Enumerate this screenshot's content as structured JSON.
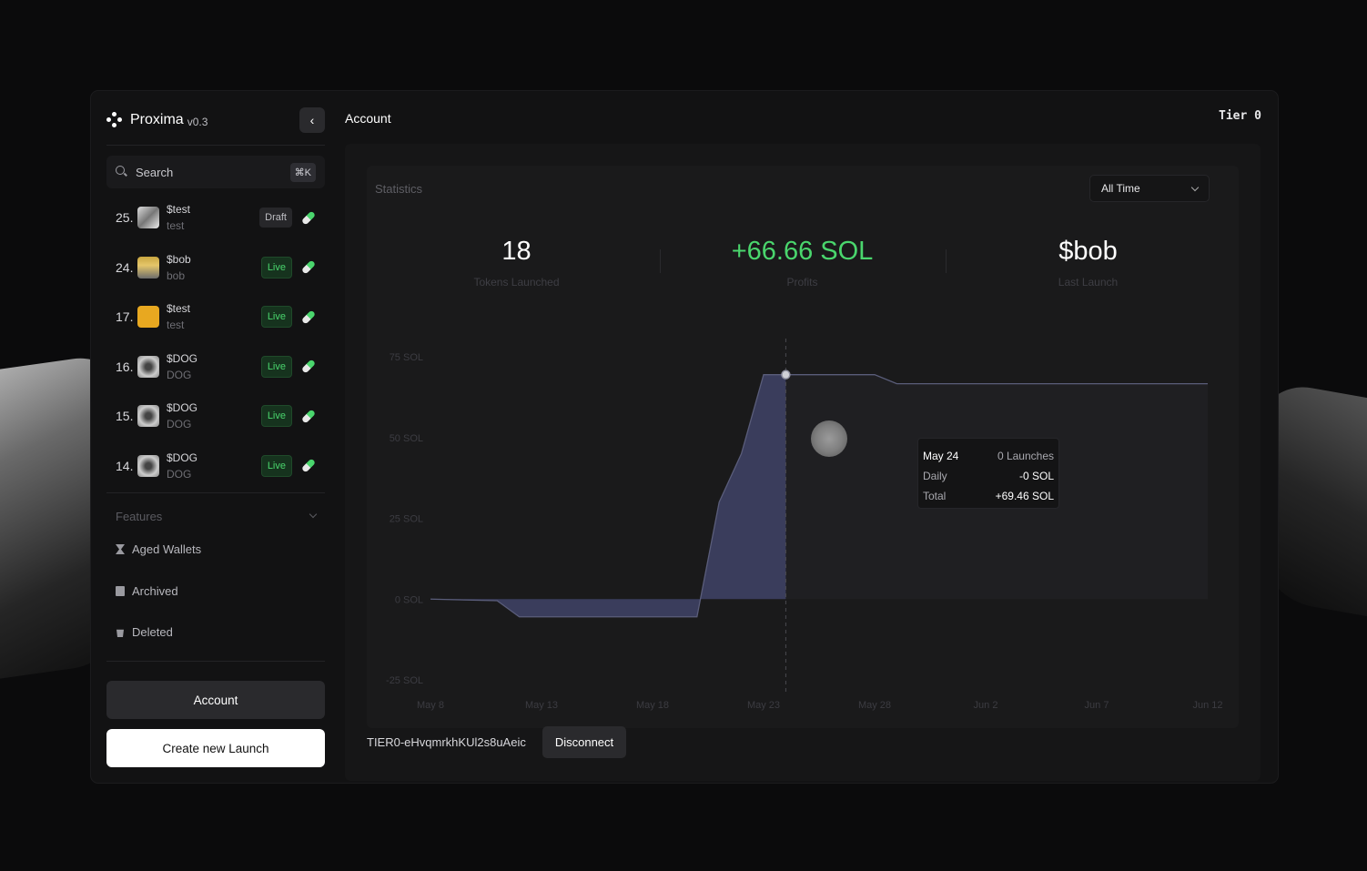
{
  "app": {
    "name": "Proxima",
    "version": "v0.3"
  },
  "sidebar": {
    "search_placeholder": "Search",
    "search_shortcut": "⌘K",
    "launches": [
      {
        "number": "25.",
        "ticker": "$test",
        "name": "test",
        "status": "Draft"
      },
      {
        "number": "24.",
        "ticker": "$bob",
        "name": "bob",
        "status": "Live"
      },
      {
        "number": "17.",
        "ticker": "$test",
        "name": "test",
        "status": "Live"
      },
      {
        "number": "16.",
        "ticker": "$DOG",
        "name": "DOG",
        "status": "Live"
      },
      {
        "number": "15.",
        "ticker": "$DOG",
        "name": "DOG",
        "status": "Live"
      },
      {
        "number": "14.",
        "ticker": "$DOG",
        "name": "DOG",
        "status": "Live"
      }
    ],
    "features_label": "Features",
    "features": [
      {
        "label": "Aged Wallets",
        "icon": "hourglass-icon"
      },
      {
        "label": "Archived",
        "icon": "archive-icon"
      },
      {
        "label": "Deleted",
        "icon": "trash-icon"
      }
    ],
    "account_button": "Account",
    "create_button": "Create new Launch"
  },
  "main": {
    "title": "Account",
    "tier": "Tier 0",
    "statistics_label": "Statistics",
    "range": "All Time",
    "kpis": [
      {
        "value": "18",
        "label": "Tokens Launched"
      },
      {
        "value": "+66.66 SOL",
        "label": "Profits"
      },
      {
        "value": "$bob",
        "label": "Last Launch"
      }
    ],
    "tooltip": {
      "date": "May 24",
      "launches": "0 Launches",
      "daily_label": "Daily",
      "daily_value": "-0 SOL",
      "total_label": "Total",
      "total_value": "+69.46 SOL"
    },
    "wallet_id": "TIER0-eHvqmrkhKUl2s8uAeic",
    "disconnect_button": "Disconnect"
  },
  "colors": {
    "profit_green": "#4ad66d",
    "area_fill": "#3a3d5c",
    "live_badge": "#16331e"
  },
  "chart_data": {
    "type": "area",
    "ylabel_ticks": [
      "75 SOL",
      "50 SOL",
      "25 SOL",
      "0 SOL",
      "-25 SOL"
    ],
    "yticks": [
      75,
      50,
      25,
      0,
      -25
    ],
    "ylim": [
      -25,
      75
    ],
    "xticks": [
      "May 8",
      "May 13",
      "May 18",
      "May 23",
      "May 28",
      "Jun 2",
      "Jun 7",
      "Jun 12"
    ],
    "x": [
      "May 8",
      "May 11",
      "May 12",
      "May 16",
      "May 20",
      "May 21",
      "May 22",
      "May 23",
      "May 24",
      "May 28",
      "May 29",
      "Jun 12"
    ],
    "series": [
      {
        "values": [
          0,
          -0.5,
          -5.5,
          -5.5,
          -5.5,
          30,
          45,
          69.46,
          69.46,
          69.46,
          66.66,
          66.66
        ]
      }
    ],
    "highlight": {
      "x": "May 24",
      "y": 69.46
    },
    "grid": false
  }
}
